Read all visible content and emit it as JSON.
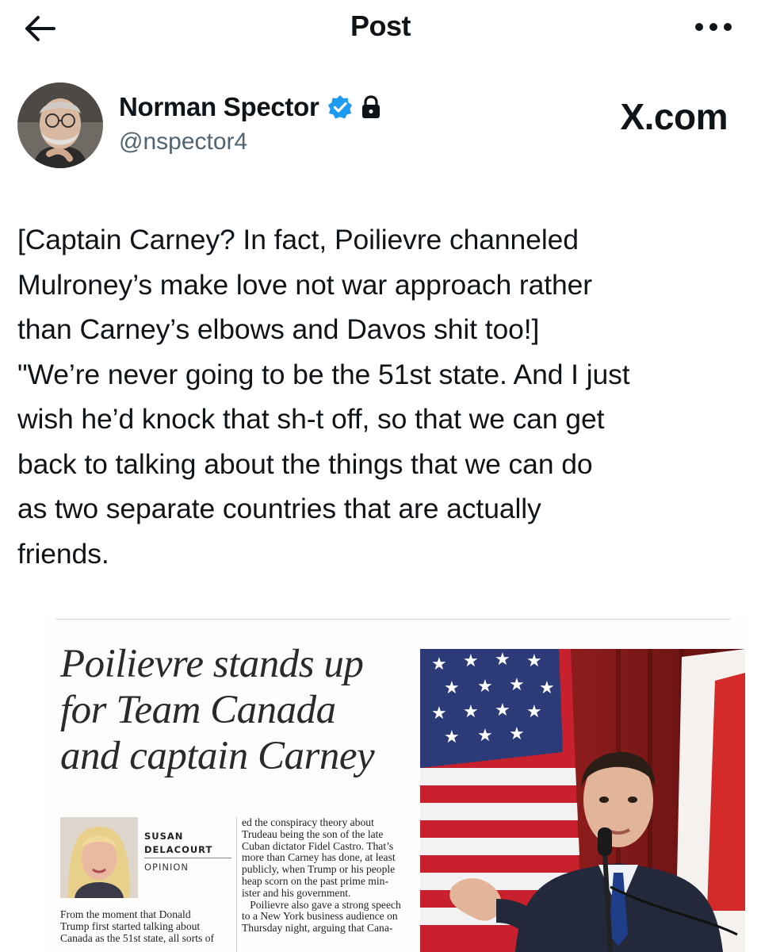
{
  "topbar": {
    "title": "Post",
    "back_icon": "arrow-left-icon",
    "more_icon": "more-horizontal-icon"
  },
  "author": {
    "name": "Norman Spector",
    "handle": "@nspector4",
    "verified_icon": "verified-badge-icon",
    "protected_icon": "lock-icon",
    "verified_color": "#1d9bf0"
  },
  "brand_watermark": "X.com",
  "post": {
    "lines": [
      "[Captain Carney? In fact, Poilievre channeled",
      "Mulroney’s make love not war approach rather",
      "than Carney’s elbows and Davos shit too!]",
      "\"We’re never going to be the 51st state. And I just",
      "wish he’d knock that sh-t off, so that we can get",
      "back to talking about the things that we can do",
      "as two separate countries that are actually",
      "friends."
    ]
  },
  "article": {
    "headline_lines": [
      "Poilievre stands up",
      "for Team Canada",
      "and captain Carney"
    ],
    "byline_first": "SUSAN",
    "byline_last": "DELACOURT",
    "byline_tag": "OPINION",
    "left_column": [
      "From the moment that Donald",
      "Trump first started talking about",
      "Canada as the 51st state, all sorts of"
    ],
    "right_column": [
      "ed the conspiracy theory about",
      "Trudeau being the son of the late",
      "Cuban dictator Fidel Castro. That’s",
      "more than Carney has done, at least",
      "publicly, when Trump or his people",
      "heap scorn on the past prime min-",
      "ister and his government.",
      "   Poilievre also gave a strong speech",
      "to a New York business audience on",
      "Thursday night, arguing that Cana-"
    ]
  }
}
